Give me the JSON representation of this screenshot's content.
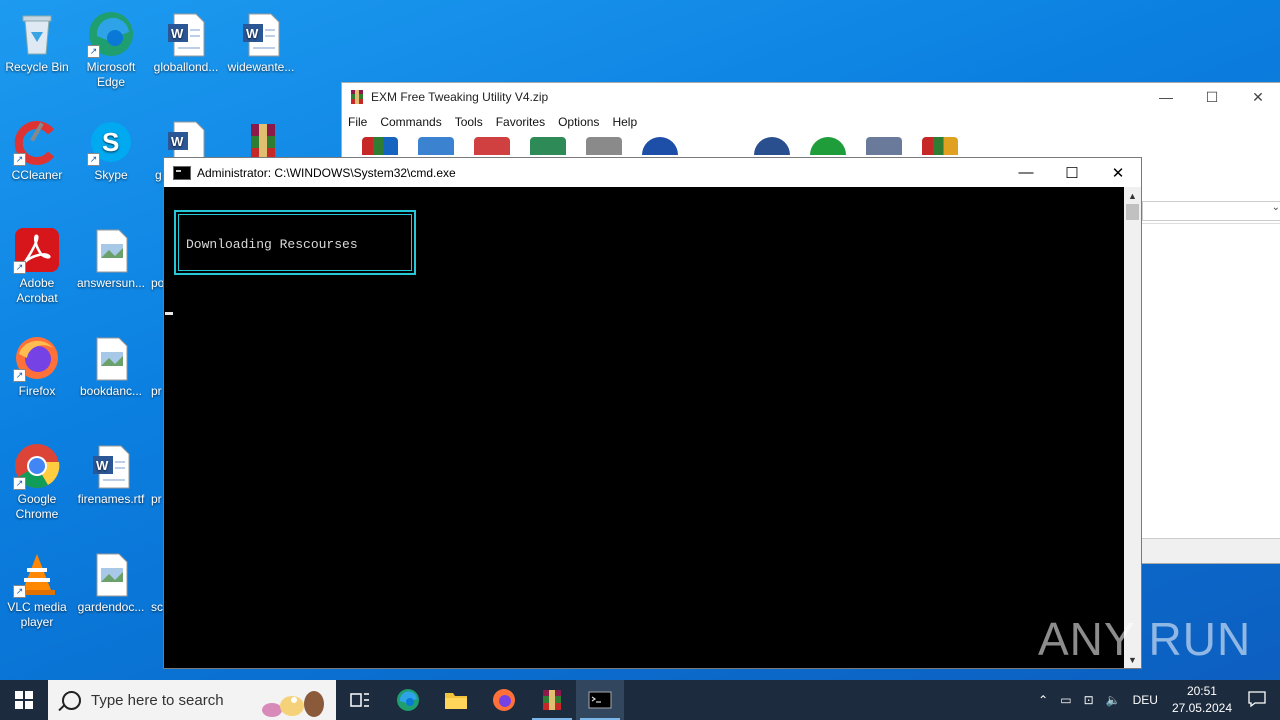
{
  "desktop": {
    "icons": [
      {
        "label": "Recycle Bin"
      },
      {
        "label": "Microsoft Edge"
      },
      {
        "label": "globallond..."
      },
      {
        "label": "widewante..."
      },
      {
        "label": "CCleaner"
      },
      {
        "label": "Skype"
      },
      {
        "label": "g"
      },
      {
        "label": "Adobe Acrobat"
      },
      {
        "label": "answersun..."
      },
      {
        "label": "po"
      },
      {
        "label": "Firefox"
      },
      {
        "label": "bookdanc..."
      },
      {
        "label": "pr"
      },
      {
        "label": "Google Chrome"
      },
      {
        "label": "firenames.rtf"
      },
      {
        "label": "pr"
      },
      {
        "label": "VLC media player"
      },
      {
        "label": "gardendoc..."
      },
      {
        "label": "sc"
      }
    ]
  },
  "winrar": {
    "title": "EXM Free Tweaking Utility V4.zip",
    "menu": [
      "File",
      "Commands",
      "Tools",
      "Favorites",
      "Options",
      "Help"
    ],
    "controls": {
      "minimize": "—",
      "maximize": "☐",
      "close": "✕"
    }
  },
  "cmd": {
    "title": "Administrator: C:\\WINDOWS\\System32\\cmd.exe",
    "box_text": "Downloading Rescourses",
    "controls": {
      "minimize": "—",
      "maximize": "☐",
      "close": "✕"
    },
    "border_color": "#25c7d9"
  },
  "watermark": "ANY RUN",
  "taskbar": {
    "search_placeholder": "Type here to search",
    "language": "DEU",
    "time": "20:51",
    "date": "27.05.2024"
  }
}
